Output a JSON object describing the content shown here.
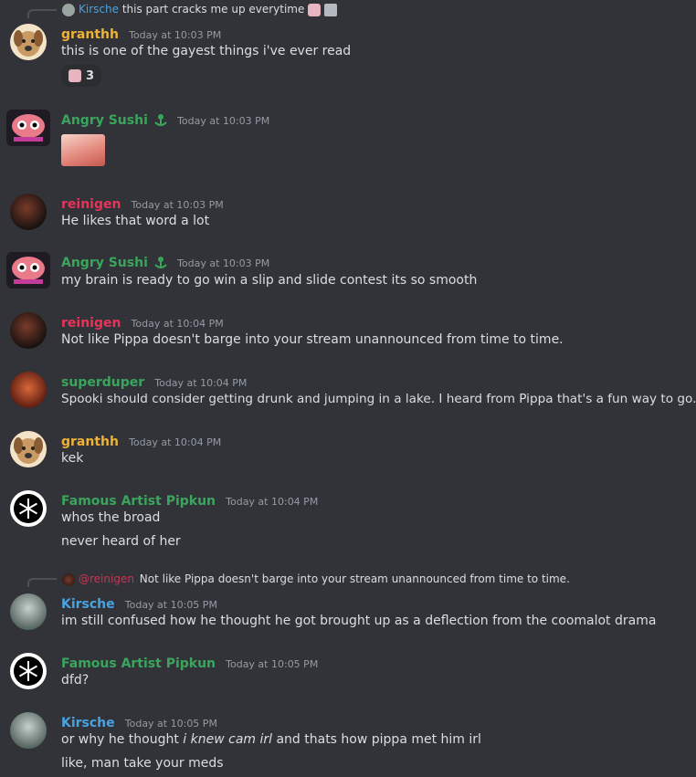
{
  "reply0": {
    "author": "Kirsche",
    "text": "this part cracks me up everytime"
  },
  "msg1": {
    "author": "granthh",
    "ts": "Today at 10:03 PM",
    "text": "this is one of the gayest things i've ever read",
    "reaction_count": "3"
  },
  "msg2": {
    "author": "Angry Sushi",
    "ts": "Today at 10:03 PM"
  },
  "msg3": {
    "author": "reinigen",
    "ts": "Today at 10:03 PM",
    "text": "He likes that word a lot"
  },
  "msg4": {
    "author": "Angry Sushi",
    "ts": "Today at 10:03 PM",
    "text": "my brain is ready to go win a slip and slide contest its so smooth"
  },
  "msg5": {
    "author": "reinigen",
    "ts": "Today at 10:04 PM",
    "text": "Not like Pippa doesn't barge into your stream unannounced from time to time."
  },
  "msg6": {
    "author": "superduper",
    "ts": "Today at 10:04 PM",
    "text": "Spooki should consider getting drunk and jumping in a lake.  I heard from Pippa that's a fun way to go."
  },
  "msg7": {
    "author": "granthh",
    "ts": "Today at 10:04 PM",
    "text": "kek"
  },
  "msg8": {
    "author": "Famous Artist Pipkun",
    "ts": "Today at 10:04 PM",
    "text": "whos the broad",
    "text2": "never heard of her"
  },
  "reply9": {
    "mention": "@reinigen",
    "text": "Not like Pippa doesn't barge into your stream unannounced from time to time."
  },
  "msg9": {
    "author": "Kirsche",
    "ts": "Today at 10:05 PM",
    "text": "im still confused how he thought he got brought up as a deflection from the coomalot drama"
  },
  "msg10": {
    "author": "Famous Artist Pipkun",
    "ts": "Today at 10:05 PM",
    "text": "dfd?"
  },
  "msg11": {
    "author": "Kirsche",
    "ts": "Today at 10:05 PM",
    "text_a": "or why he thought ",
    "text_b": "i knew cam irl",
    "text_c": " and thats how pippa met him irl",
    "text2": "like, man take your meds"
  },
  "colors": {
    "granthh": "#f0b232",
    "sushi": "#3ba55d",
    "reinigen": "#e8335a",
    "superduper": "#3ba55d",
    "pipkun": "#3ba55d",
    "kirsche": "#4aa3df"
  }
}
